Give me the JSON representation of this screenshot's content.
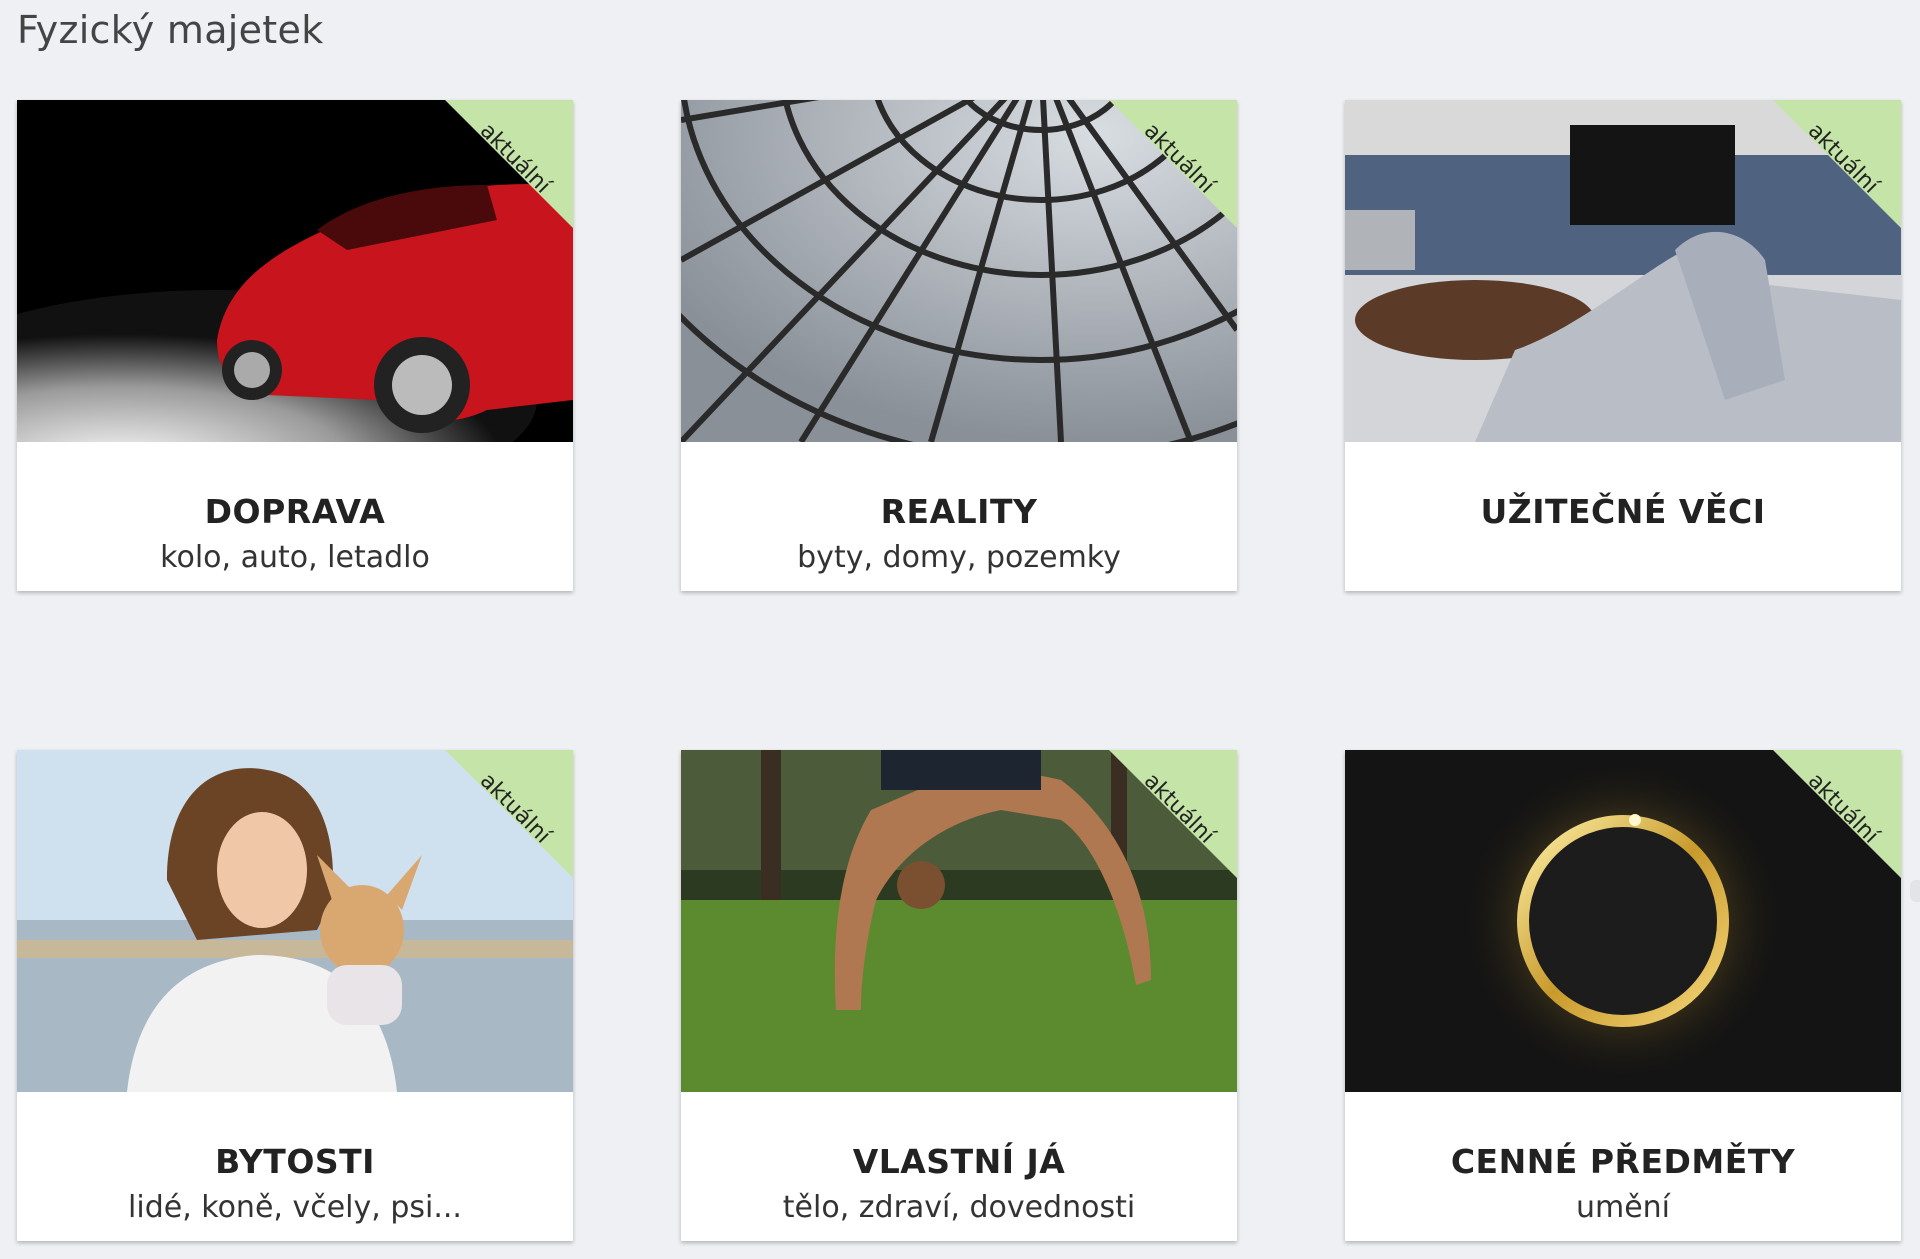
{
  "page": {
    "title": "Fyzický majetek"
  },
  "badge_label": "aktuální",
  "colors": {
    "background": "#eef0f3",
    "badge": "#c5e4a8",
    "card": "#ffffff"
  },
  "cards": [
    {
      "title": "DOPRAVA",
      "subtitle": "kolo, auto, letadlo",
      "image": "red-sports-car"
    },
    {
      "title": "REALITY",
      "subtitle": "byty, domy, pozemky",
      "image": "glass-dome"
    },
    {
      "title": "UŽITEČNÉ VĚCI",
      "subtitle": "",
      "image": "living-room"
    },
    {
      "title": "BYTOSTI",
      "subtitle": "lidé, koně, včely, psi...",
      "image": "woman-with-dog"
    },
    {
      "title": "VLASTNÍ JÁ",
      "subtitle": "tělo, zdraví, dovednosti",
      "image": "yoga-in-park"
    },
    {
      "title": "CENNÉ PŘEDMĚTY",
      "subtitle": "umění",
      "image": "gold-ring"
    }
  ]
}
